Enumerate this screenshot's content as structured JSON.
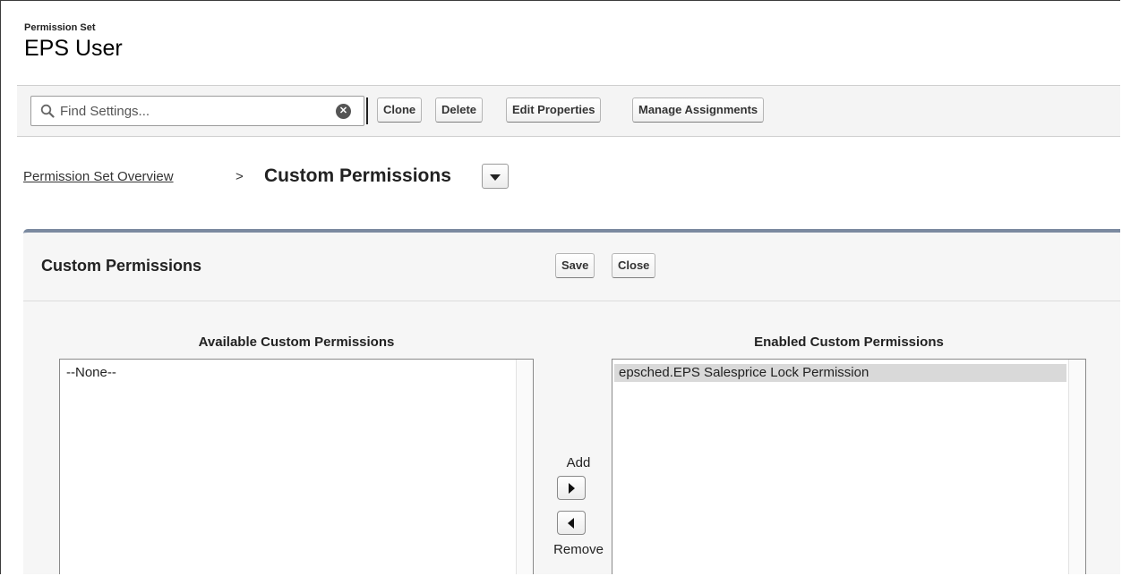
{
  "header": {
    "eyebrow": "Permission Set",
    "title": "EPS User"
  },
  "toolbar": {
    "search_placeholder": "Find Settings...",
    "buttons": {
      "clone": "Clone",
      "delete": "Delete",
      "edit_properties": "Edit Properties",
      "manage_assignments": "Manage Assignments"
    }
  },
  "breadcrumb": {
    "link": "Permission Set Overview",
    "separator": ">",
    "current": "Custom Permissions"
  },
  "panel": {
    "title": "Custom Permissions",
    "save_label": "Save",
    "close_label": "Close",
    "available": {
      "title": "Available Custom Permissions",
      "items": [
        "--None--"
      ]
    },
    "enabled": {
      "title": "Enabled Custom Permissions",
      "items": [
        "epsched.EPS Salesprice Lock Permission"
      ]
    },
    "mover": {
      "add_label": "Add",
      "remove_label": "Remove"
    }
  },
  "colors": {
    "panel_accent": "#7b8aa0",
    "toolbar_bg": "#f4f4f4",
    "selected_item_bg": "#d9d9d9"
  }
}
